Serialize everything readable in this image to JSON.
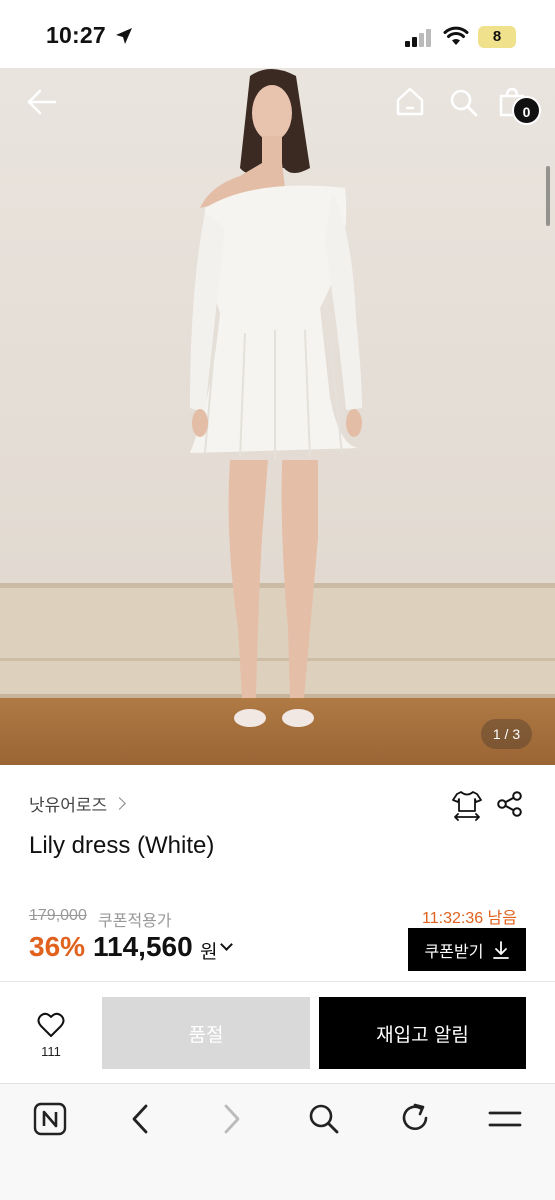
{
  "status_bar": {
    "time": "10:27",
    "battery": "8"
  },
  "hero": {
    "page_counter": "1 / 3",
    "cart_count": "0"
  },
  "product": {
    "brand": "낫유어로즈",
    "name": "Lily dress (White)",
    "original_price": "179,000",
    "coupon_note": "쿠폰적용가",
    "timer": "11:32:36 남음",
    "discount": "36%",
    "price": "114,560",
    "currency": "원",
    "coupon_button": "쿠폰받기"
  },
  "actions": {
    "like_count": "111",
    "soldout_label": "품절",
    "restock_label": "재입고 알림"
  },
  "colors": {
    "accent": "#e0621e",
    "primary_button": "#000000",
    "disabled_button": "#d9d9d9"
  },
  "icons": [
    "location-arrow-icon",
    "signal-icon",
    "wifi-icon",
    "back-arrow-icon",
    "home-icon",
    "search-icon",
    "shopping-bag-icon",
    "size-guide-icon",
    "share-icon",
    "heart-icon",
    "download-icon",
    "naver-icon",
    "browser-back-icon",
    "browser-forward-icon",
    "browser-search-icon",
    "refresh-icon",
    "menu-icon"
  ]
}
